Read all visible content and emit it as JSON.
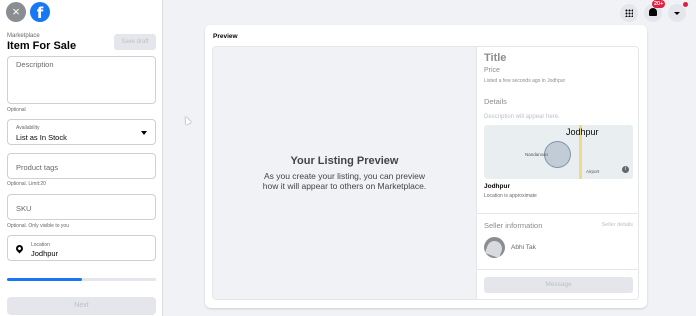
{
  "app": {
    "close_icon": "×",
    "logo_letter": "f"
  },
  "form": {
    "breadcrumb": "Marketplace",
    "title": "Item For Sale",
    "save_draft": "Save draft",
    "description": {
      "placeholder": "Description",
      "helper": "Optional"
    },
    "availability": {
      "label": "Availability",
      "value": "List as In Stock"
    },
    "product_tags": {
      "placeholder": "Product tags",
      "helper": "Optional. Limit:20"
    },
    "sku": {
      "placeholder": "SKU",
      "helper": "Optional. Only visible to you"
    },
    "location": {
      "label": "Location",
      "value": "Jodhpur"
    },
    "progress_fraction": 0.5,
    "next": "Next"
  },
  "header": {
    "notification_badge": "20+",
    "colors": {
      "accent": "#1877f2",
      "badge": "#e41e3f"
    }
  },
  "preview": {
    "heading": "Preview",
    "placeholder_title": "Your Listing Preview",
    "placeholder_text_1": "As you create your listing, you can preview",
    "placeholder_text_2": "how it will appear to others on Marketplace.",
    "title": "Title",
    "price": "Price",
    "listed": "Listed a few seconds ago in Jodhpur",
    "details": "Details",
    "description": "Description will appear here.",
    "map_city": "Jodhpur",
    "map_area": "Nandanvan",
    "map_airport": "Airport",
    "city": "Jodhpur",
    "approx": "Location is approximate",
    "seller_heading": "Seller information",
    "seller_details": "Seller details",
    "seller_name": "Abhi Tak",
    "message": "Message"
  }
}
